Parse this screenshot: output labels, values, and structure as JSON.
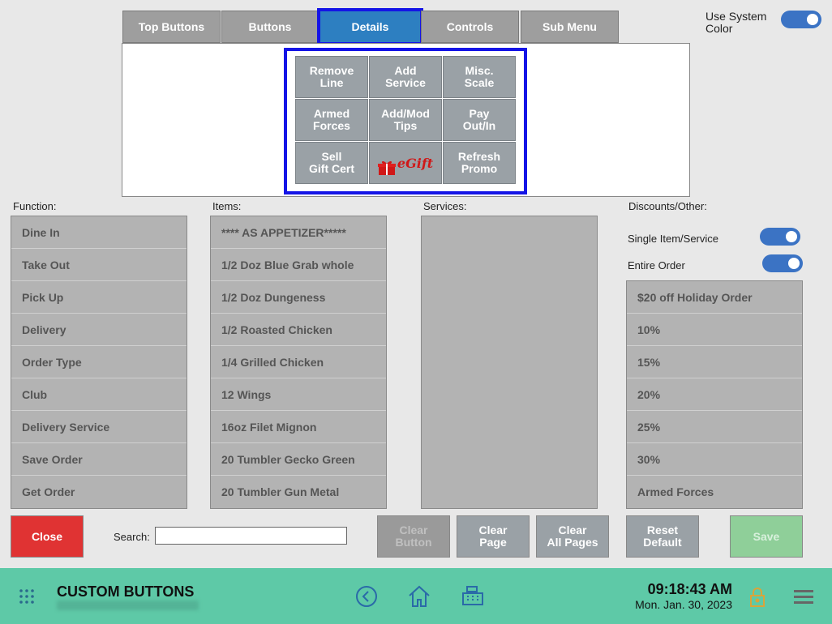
{
  "tabs": [
    "Top Buttons",
    "Buttons",
    "Details",
    "Controls",
    "Sub Menu"
  ],
  "active_tab": "Details",
  "use_system_color": {
    "label": "Use System Color",
    "enabled": true
  },
  "grid_buttons": [
    "Remove\nLine",
    "Add\nService",
    "Misc.\nScale",
    "Armed\nForces",
    "Add/Mod\nTips",
    "Pay\nOut/In",
    "Sell\nGift Cert",
    "eGift",
    "Refresh\nPromo"
  ],
  "function": {
    "label": "Function:",
    "items": [
      "Dine In",
      "Take Out",
      "Pick Up",
      "Delivery",
      "Order Type",
      "Club",
      "Delivery Service",
      "Save Order",
      "Get Order"
    ]
  },
  "items": {
    "label": "Items:",
    "items": [
      "**** AS APPETIZER*****",
      "1/2 Doz Blue Grab whole",
      "1/2 Doz Dungeness",
      "1/2 Roasted Chicken",
      "1/4 Grilled Chicken",
      "12 Wings",
      "16oz Filet Mignon",
      "20 Tumbler Gecko Green",
      "20 Tumbler Gun Metal"
    ]
  },
  "services": {
    "label": "Services:",
    "items": []
  },
  "discounts": {
    "label": "Discounts/Other:",
    "single_item_label": "Single Item/Service",
    "entire_order_label": "Entire Order",
    "items": [
      "$20 off Holiday Order",
      "10%",
      "15%",
      "20%",
      "25%",
      "30%",
      "Armed Forces"
    ]
  },
  "actions": {
    "close": "Close",
    "search_label": "Search:",
    "search_value": "",
    "clear_button": "Clear\nButton",
    "clear_page": "Clear\nPage",
    "clear_all_pages": "Clear\nAll Pages",
    "reset_default": "Reset\nDefault",
    "save": "Save"
  },
  "footer": {
    "title": "CUSTOM BUTTONS",
    "time": "09:18:43 AM",
    "date": "Mon. Jan. 30, 2023"
  },
  "colors": {
    "accent_blue": "#2d7fc1",
    "highlight": "#1414e6",
    "close_red": "#e03333",
    "save_green": "#8fcf99",
    "footer_teal": "#5ec9a7"
  }
}
